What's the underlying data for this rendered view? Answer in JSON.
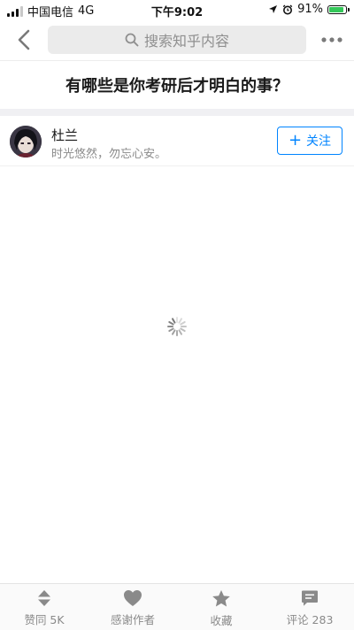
{
  "status_bar": {
    "carrier": "中国电信",
    "network": "4G",
    "time": "下午9:02",
    "battery_percent": "91%",
    "battery_level": 0.91,
    "battery_color": "#34c759"
  },
  "nav": {
    "back_icon": "chevron-left-icon",
    "search_placeholder": "搜索知乎内容",
    "more_icon": "ellipsis-icon"
  },
  "question": {
    "title": "有哪些是你考研后才明白的事？"
  },
  "author": {
    "name": "杜兰",
    "bio": "时光悠然，勿忘心安。",
    "follow_label": "关注"
  },
  "content": {
    "loading_icon": "loading-spinner-icon"
  },
  "bottom_bar": {
    "tabs": [
      {
        "icon": "vote-arrows-icon",
        "label": "赞同 5K"
      },
      {
        "icon": "heart-icon",
        "label": "感谢作者"
      },
      {
        "icon": "star-icon",
        "label": "收藏"
      },
      {
        "icon": "comment-icon",
        "label": "评论 283"
      }
    ]
  },
  "colors": {
    "accent": "#0084ff",
    "icon_gray": "#8a8a8a",
    "divider_band": "#f0f0f3"
  }
}
